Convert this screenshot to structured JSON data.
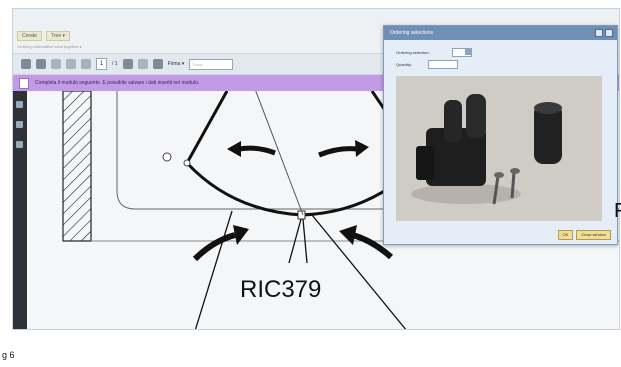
{
  "topbar": {
    "tabs": [
      "Create",
      "Tree ▾"
    ],
    "breadcrumb": "Ordering information work together ▸"
  },
  "toolbar": {
    "page_current": "1",
    "page_total": "/ 1",
    "sign_label": "Firma ▾",
    "find_placeholder": "Trova"
  },
  "banner": {
    "text": "Completa il modulo seguente. È possibile salvare i dati inseriti nel modulo."
  },
  "drawing": {
    "part_label": "RIC379"
  },
  "dialog": {
    "title": "Ordering selections",
    "field_ordering_label": "Ordering selection:",
    "field_ordering_value": "1",
    "field_quantity_label": "Quantity:",
    "field_quantity_value": "",
    "ok_label": "OK",
    "close_label": "Close window"
  },
  "caption": {
    "text": "g 6"
  },
  "edge_fragment": {
    "text": "F"
  }
}
